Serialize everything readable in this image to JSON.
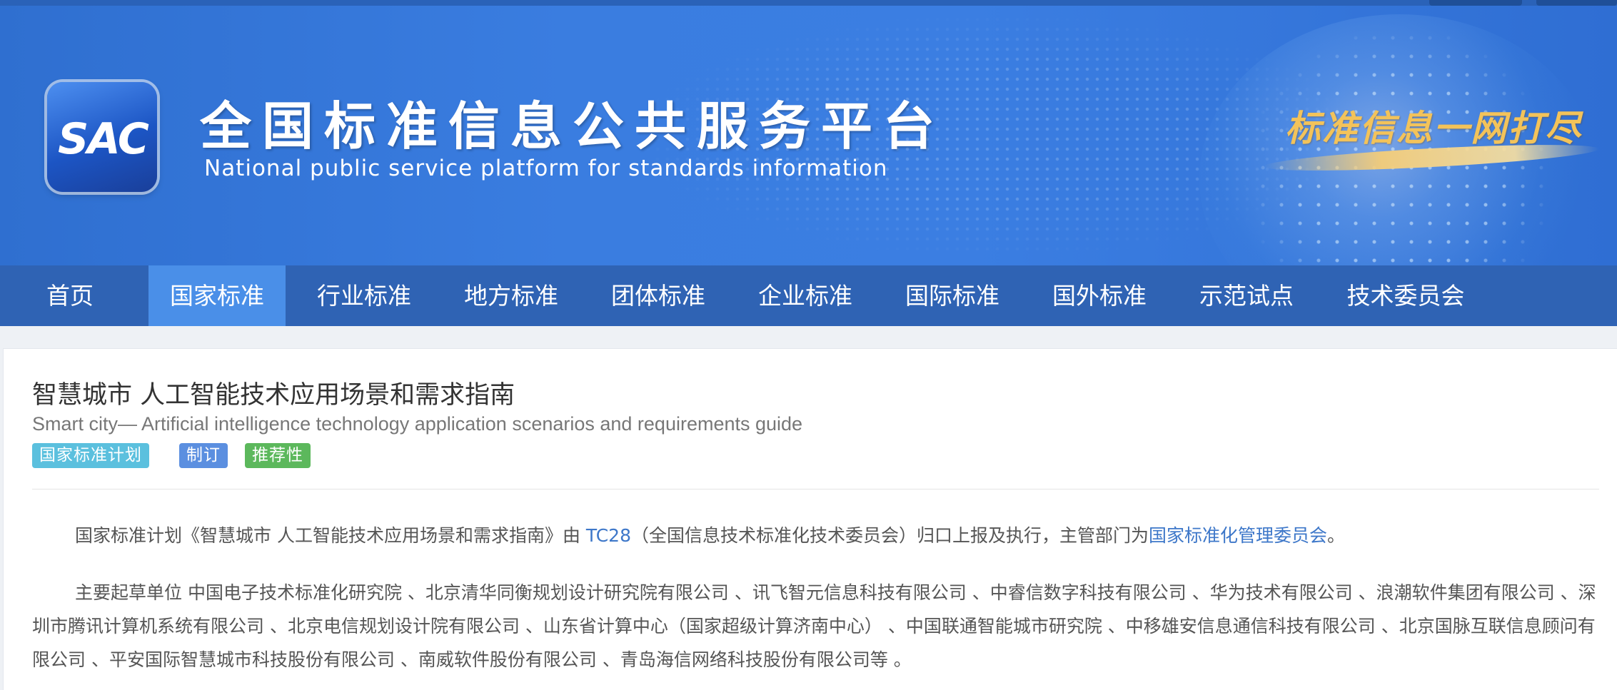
{
  "header": {
    "logo_text": "SAC",
    "title": "全国标准信息公共服务平台",
    "subtitle": "National public service platform  for standards information",
    "slogan": "标准信息一网打尽"
  },
  "nav": {
    "items": [
      {
        "label": "首页"
      },
      {
        "label": "国家标准"
      },
      {
        "label": "行业标准"
      },
      {
        "label": "地方标准"
      },
      {
        "label": "团体标准"
      },
      {
        "label": "企业标准"
      },
      {
        "label": "国际标准"
      },
      {
        "label": "国外标准"
      },
      {
        "label": "示范试点"
      },
      {
        "label": "技术委员会"
      }
    ],
    "active": "国家标准"
  },
  "standard": {
    "title": "智慧城市 人工智能技术应用场景和需求指南",
    "title_en": "Smart city— Artificial intelligence technology application scenarios and requirements guide",
    "tags": [
      {
        "label": "国家标准计划",
        "color": "#5bc0de"
      },
      {
        "label": "制订",
        "color": "#5b8fe0"
      },
      {
        "label": "推荐性",
        "color": "#5cb85c"
      }
    ],
    "summary": {
      "prefix": "国家标准计划《智慧城市 人工智能技术应用场景和需求指南》由 ",
      "tc_link": "TC28",
      "middle": "（全国信息技术标准化技术委员会）归口上报及执行，主管部门为",
      "dept_link": "国家标准化管理委员会",
      "suffix": "。"
    },
    "drafters": "主要起草单位 中国电子技术标准化研究院 、北京清华同衡规划设计研究院有限公司 、讯飞智元信息科技有限公司 、中睿信数字科技有限公司 、华为技术有限公司 、浪潮软件集团有限公司 、深圳市腾讯计算机系统有限公司 、北京电信规划设计院有限公司 、山东省计算中心（国家超级计算济南中心） 、中国联通智能城市研究院 、中移雄安信息通信科技有限公司 、北京国脉互联信息顾问有限公司 、平安国际智慧城市科技股份有限公司 、南威软件股份有限公司 、青岛海信网络科技股份有限公司等 。"
  },
  "colors": {
    "banner": "#3a7de0",
    "nav": "#2f63b4",
    "nav_active": "#4a8fe8",
    "link": "#3d77c9"
  }
}
